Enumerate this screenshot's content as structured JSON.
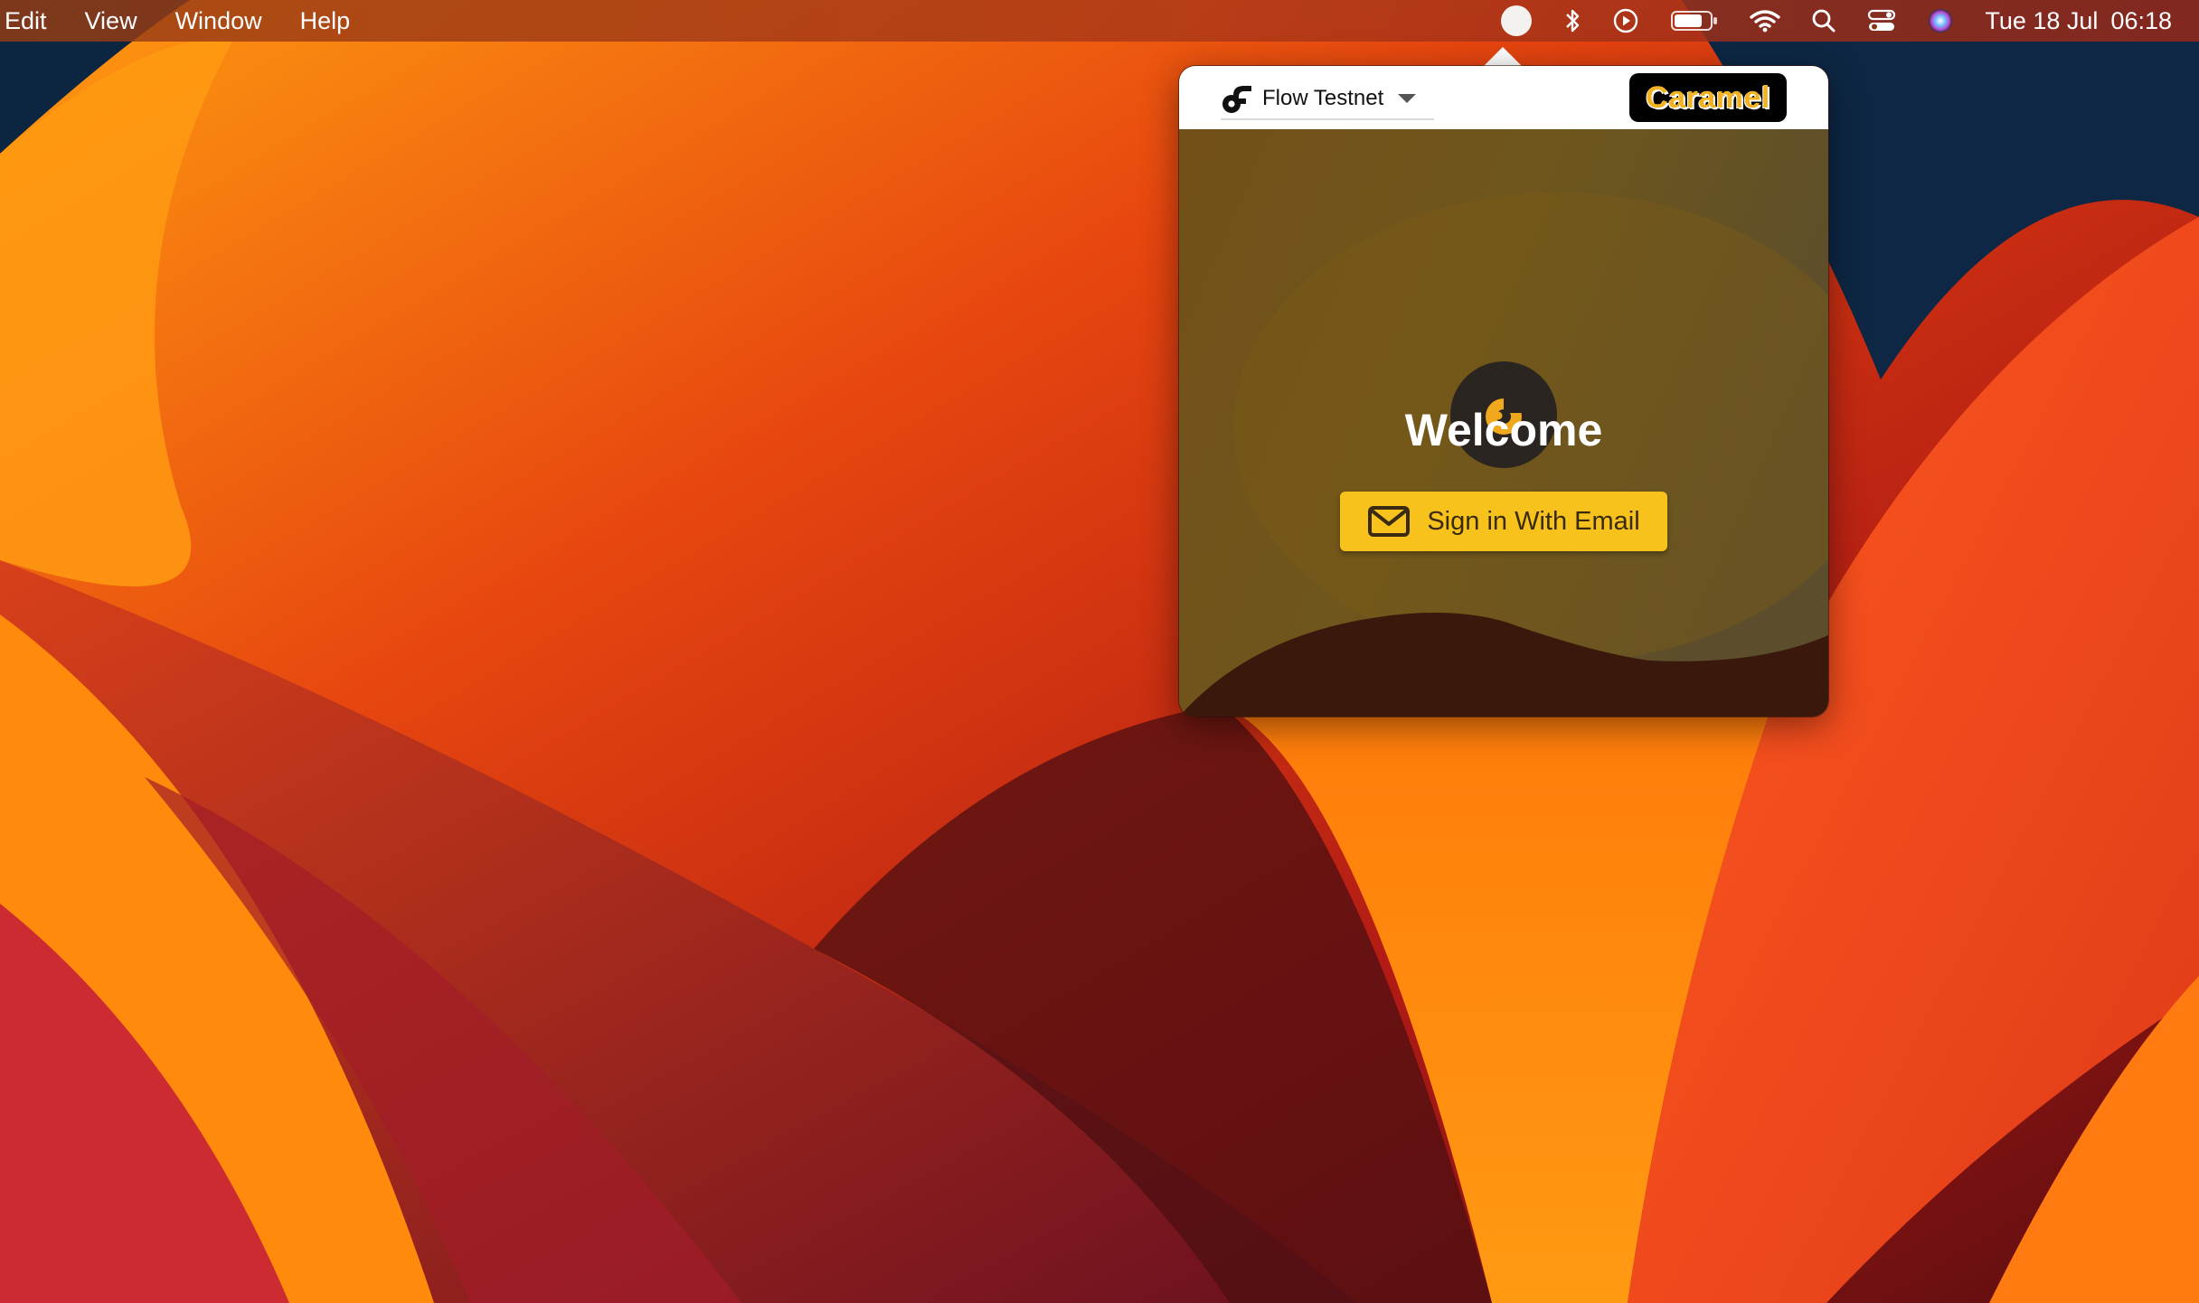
{
  "menubar": {
    "items": [
      "Edit",
      "View",
      "Window",
      "Help"
    ],
    "status_icons": [
      "caramel-app-icon",
      "bluetooth-icon",
      "play-icon",
      "battery-icon",
      "wifi-icon",
      "search-icon",
      "control-center-icon",
      "siri-icon"
    ],
    "clock_date": "Tue 18 Jul",
    "clock_time": "06:18"
  },
  "popover": {
    "network_label": "Flow Testnet",
    "network_icon": "flow-logo-icon",
    "brand": "Caramel",
    "welcome": "Welcome",
    "signin_label": "Sign in With Email",
    "signin_icon": "mail-icon"
  },
  "colors": {
    "accent": "#f6c21b",
    "panel": "#6f5219",
    "wave": "#3a1a0c",
    "brand_text": "#f3b320"
  }
}
